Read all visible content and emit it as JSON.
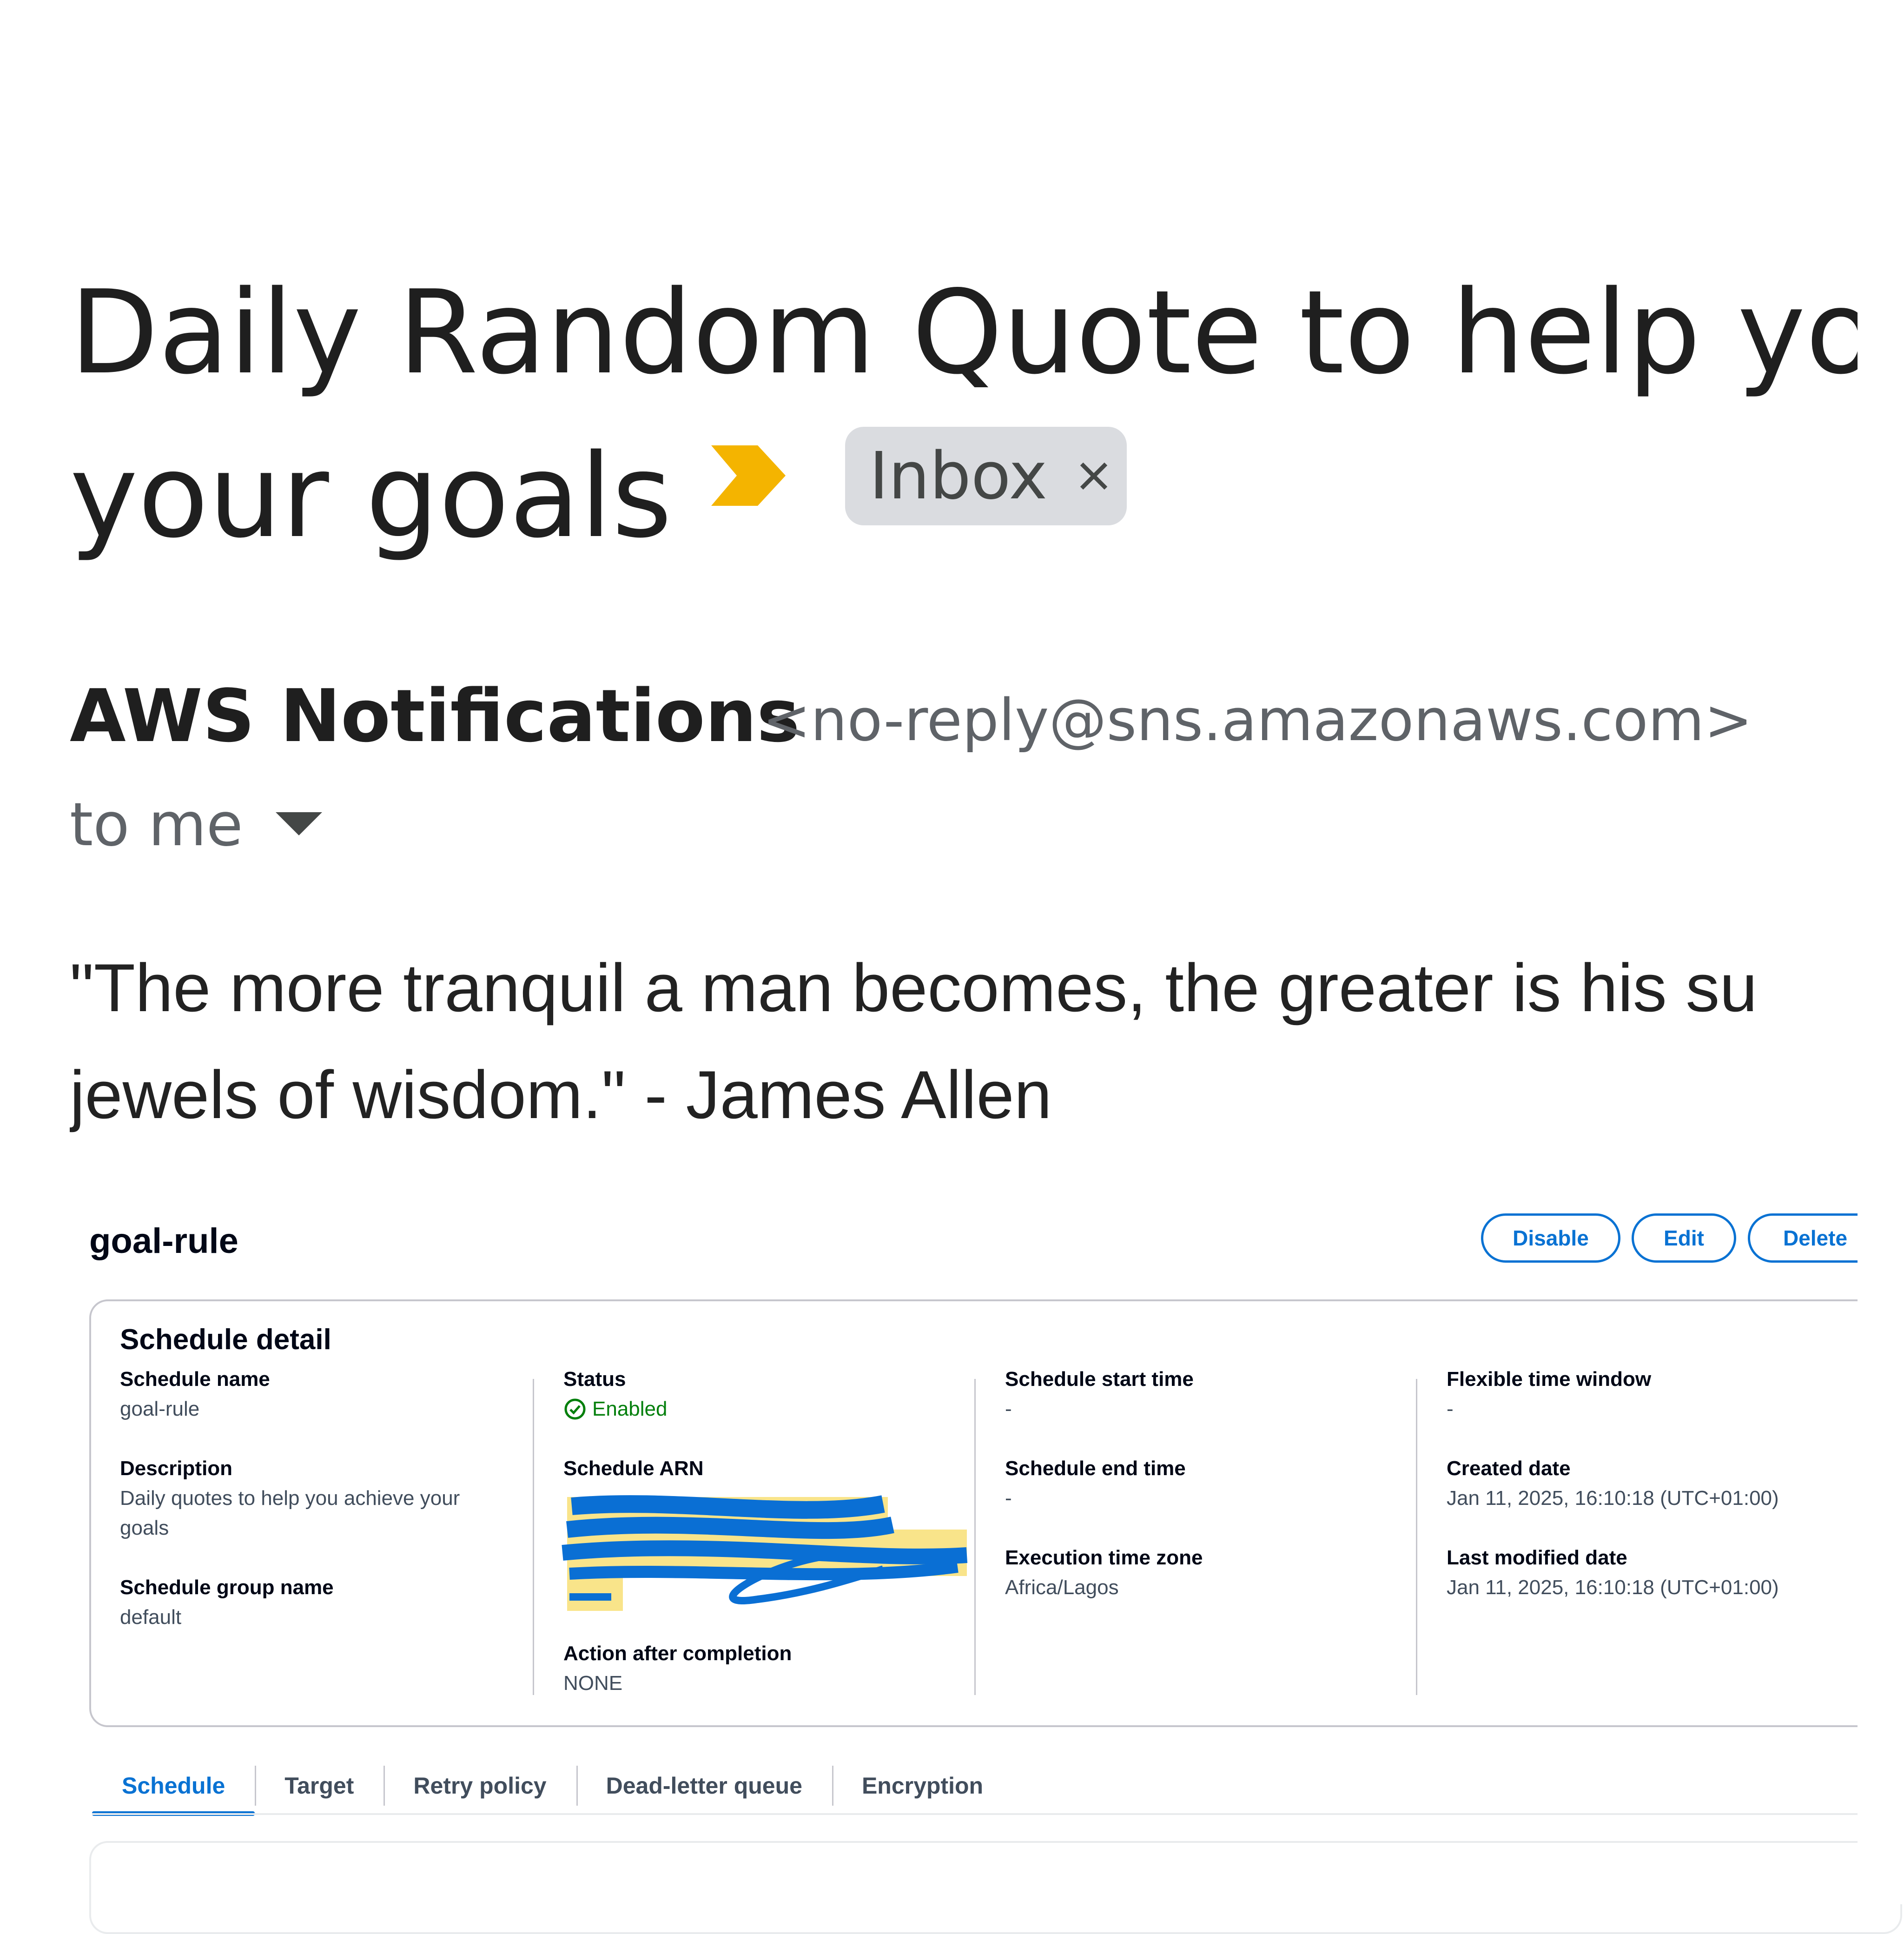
{
  "email": {
    "subject_line1": "Daily Random Quote to help you",
    "subject_line2": "your goals",
    "label_chip": "Inbox",
    "sender_name": "AWS Notifications",
    "sender_email": "<no-reply@sns.amazonaws.com>",
    "recipient": "to me",
    "body_line1": "\"The more tranquil a man becomes, the greater is his su",
    "body_line2": "jewels of wisdom.\" - James Allen"
  },
  "rule": {
    "title": "goal-rule",
    "buttons": {
      "disable": "Disable",
      "edit": "Edit",
      "delete": "Delete"
    }
  },
  "schedule_detail": {
    "title": "Schedule detail",
    "schedule_name": {
      "label": "Schedule name",
      "value": "goal-rule"
    },
    "description": {
      "label": "Description",
      "value": "Daily quotes to help you achieve your goals"
    },
    "schedule_group_name": {
      "label": "Schedule group name",
      "value": "default"
    },
    "status": {
      "label": "Status",
      "value": "Enabled"
    },
    "schedule_arn": {
      "label": "Schedule ARN"
    },
    "action_after_completion": {
      "label": "Action after completion",
      "value": "NONE"
    },
    "schedule_start_time": {
      "label": "Schedule start time",
      "value": "-"
    },
    "schedule_end_time": {
      "label": "Schedule end time",
      "value": "-"
    },
    "execution_time_zone": {
      "label": "Execution time zone",
      "value": "Africa/Lagos"
    },
    "flexible_time_window": {
      "label": "Flexible time window",
      "value": "-"
    },
    "created_date": {
      "label": "Created date",
      "value": "Jan 11, 2025, 16:10:18 (UTC+01:00)"
    },
    "last_modified_date": {
      "label": "Last modified date",
      "value": "Jan 11, 2025, 16:10:18 (UTC+01:00)"
    }
  },
  "tabs": [
    "Schedule",
    "Target",
    "Retry policy",
    "Dead-letter queue",
    "Encryption"
  ],
  "colors": {
    "importance_marker": "#f4b400",
    "link_blue": "#0972d3",
    "success_green": "#037f0c",
    "redaction_blue": "#0a6fd4",
    "redaction_highlight": "#f9e48a"
  },
  "icons": {
    "importance": "importance-marker-icon",
    "chip_close": "close-icon",
    "recipient_dropdown": "caret-down-icon",
    "status": "check-circle-icon"
  }
}
